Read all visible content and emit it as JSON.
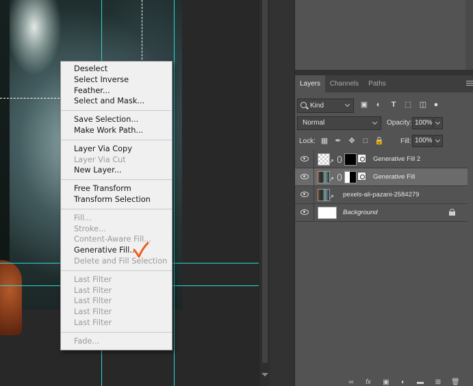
{
  "context_menu": {
    "groups": [
      [
        {
          "label": "Deselect",
          "enabled": true
        },
        {
          "label": "Select Inverse",
          "enabled": true
        },
        {
          "label": "Feather...",
          "enabled": true
        },
        {
          "label": "Select and Mask...",
          "enabled": true
        }
      ],
      [
        {
          "label": "Save Selection...",
          "enabled": true
        },
        {
          "label": "Make Work Path...",
          "enabled": true
        }
      ],
      [
        {
          "label": "Layer Via Copy",
          "enabled": true
        },
        {
          "label": "Layer Via Cut",
          "enabled": false
        },
        {
          "label": "New Layer...",
          "enabled": true
        }
      ],
      [
        {
          "label": "Free Transform",
          "enabled": true
        },
        {
          "label": "Transform Selection",
          "enabled": true
        }
      ],
      [
        {
          "label": "Fill...",
          "enabled": false
        },
        {
          "label": "Stroke...",
          "enabled": false
        },
        {
          "label": "Content-Aware Fill...",
          "enabled": false
        },
        {
          "label": "Generative Fill...",
          "enabled": true
        },
        {
          "label": "Delete and Fill Selection",
          "enabled": false
        }
      ],
      [
        {
          "label": "Last Filter",
          "enabled": false
        },
        {
          "label": "Last Filter",
          "enabled": false
        },
        {
          "label": "Last Filter",
          "enabled": false
        },
        {
          "label": "Last Filter",
          "enabled": false
        },
        {
          "label": "Last Filter",
          "enabled": false
        }
      ],
      [
        {
          "label": "Fade...",
          "enabled": false
        }
      ]
    ],
    "annotation_color": "#f05a1e"
  },
  "layers_panel": {
    "tabs": [
      {
        "label": "Layers",
        "active": true
      },
      {
        "label": "Channels",
        "active": false
      },
      {
        "label": "Paths",
        "active": false
      }
    ],
    "filter_kind": "Kind",
    "blend_mode": "Normal",
    "opacity_label": "Opacity:",
    "opacity_value": "100%",
    "lock_label": "Lock:",
    "fill_label": "Fill:",
    "fill_value": "100%",
    "layers": [
      {
        "name": "Generative Fill 2",
        "type": "generative",
        "thumb": "transparent",
        "mask": "black",
        "selected": false,
        "italic": false,
        "locked": false
      },
      {
        "name": "Generative Fill",
        "type": "generative",
        "thumb": "photo",
        "mask": "white-strip",
        "selected": true,
        "italic": false,
        "locked": false
      },
      {
        "name": "pexels-ali-pazani-2584279",
        "type": "smart-object",
        "thumb": "photo",
        "mask": null,
        "selected": false,
        "italic": false,
        "locked": false
      },
      {
        "name": "Background",
        "type": "background",
        "thumb": "white",
        "mask": null,
        "selected": false,
        "italic": true,
        "locked": true
      }
    ]
  },
  "colors": {
    "guide": "#2fd6d6",
    "panel_bg": "#535353",
    "menu_bg": "#f0f0f0"
  }
}
